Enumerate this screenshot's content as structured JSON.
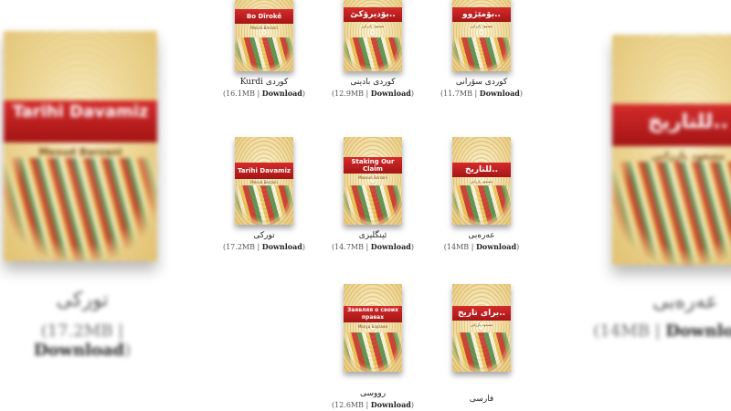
{
  "backdrop": {
    "left": {
      "cover_title": "Tarihi Davamiz",
      "cover_author": "Mesud Barzani",
      "name": "تورکی",
      "size": "17.2MB",
      "download": "Download"
    },
    "right": {
      "cover_title": "للتاريخ..",
      "cover_author": "مسعود بارزاني",
      "name": "عەرەبی",
      "size": "14MB",
      "download": "Download"
    }
  },
  "books": [
    {
      "cover_title": "Bo Dîrokê",
      "cover_author": "Mesûd Barzanî",
      "name": "Kurdi كوردی",
      "size": "16.1MB",
      "download": "Download"
    },
    {
      "cover_title": "بۆدیرۆکێ..",
      "cover_author": "مسعود بارزاني",
      "name": "كوردی بادینی",
      "size": "12.9MB",
      "download": "Download"
    },
    {
      "cover_title": "بۆمێژوو..",
      "cover_author": "مسعود بارزاني",
      "name": "كوردی سۆرانی",
      "size": "11.7MB",
      "download": "Download"
    },
    {
      "cover_title": "Tarihi Davamiz",
      "cover_author": "Mesud Barzani",
      "name": "تورکی",
      "size": "17.2MB",
      "download": "Download"
    },
    {
      "cover_title": "Staking Our Claim",
      "cover_author": "Masoud Barzani",
      "name": "ئینگلیزی",
      "size": "14.7MB",
      "download": "Download"
    },
    {
      "cover_title": "للتاريخ..",
      "cover_author": "مسعود بارزاني",
      "name": "عەرەبی",
      "size": "14MB",
      "download": "Download"
    },
    {
      "cover_title": "Заявляя о своих правах",
      "cover_author": "Масуд Барзани",
      "name": "رووسی",
      "size": "12.6MB",
      "download": "Download"
    },
    {
      "cover_title": "برای تاریخ..",
      "cover_author": "مسعود بارزاني",
      "name": "فارسی",
      "size": "",
      "download": ""
    }
  ],
  "separator": " | ",
  "colors": {
    "banner": "#c41f1f",
    "cover_bg": "#f4e0a6"
  }
}
